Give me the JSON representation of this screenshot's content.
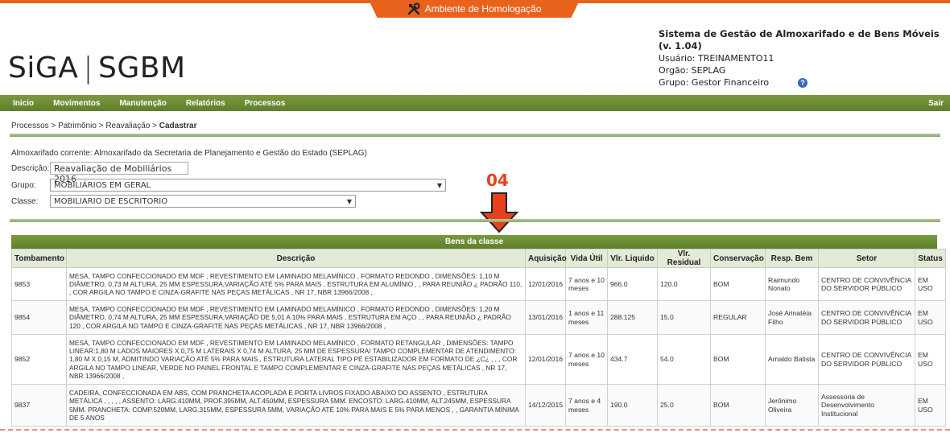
{
  "env_banner": {
    "label": "Ambiente de Homologação",
    "color": "#e8621c"
  },
  "logo": {
    "left": "SiGA",
    "right": "SGBM"
  },
  "sysinfo": {
    "title": "Sistema de Gestão de Almoxarifado e de Bens Móveis (v. 1.04)",
    "usuario": "Usuário: TREINAMENTO11",
    "orgao": "Orgão: SEPLAG",
    "grupo": "Grupo: Gestor Financeiro"
  },
  "menu": {
    "items": [
      "Inicio",
      "Movimentos",
      "Manutenção",
      "Relatórios",
      "Processos"
    ],
    "logout": "Sair"
  },
  "breadcrumb": {
    "items": [
      "Processos",
      "Patrimônio",
      "Reavaliação"
    ],
    "separator": ">",
    "current": "Cadastrar"
  },
  "form": {
    "almoxarifado": "Almoxarifado corrente: Almoxarifado da Secretaria de Planejamento e Gestão do Estado (SEPLAG)",
    "descricao_label": "Descrição:",
    "descricao_value": "Reavaliação de Mobiliários 2016",
    "grupo_label": "Grupo:",
    "grupo_value": "MOBILIÁRIOS EM GERAL",
    "classe_label": "Classe:",
    "classe_value": "MOBILIARIO DE ESCRITORIO"
  },
  "annotation": {
    "number": "04",
    "color": "#e8401c"
  },
  "table": {
    "caption": "Bens da classe",
    "headers": [
      "Tombamento",
      "Descrição",
      "Aquisição",
      "Vida Útil",
      "Vlr. Liquido",
      "Vlr. Residual",
      "Conservação",
      "Resp. Bem",
      "Setor",
      "Status"
    ],
    "rows": [
      [
        "9853",
        "MESA, TAMPO CONFECCIONADO EM MDF , REVESTIMENTO EM LAMINADO MELAMÍNICO , FORMATO REDONDO , DIMENSÕES: 1,10 M DIÂMETRO, 0,73 M ALTURA, 25 MM ESPESSURA,VARIAÇÃO ATÉ 5% PARA MAIS , ESTRUTURA EM ALUMÍNIO , , PARA REUNIÃO ¿ PADRÃO 110, , COR ARGILA NO TAMPO E CINZA-GRAFITE NAS PEÇAS METÁLICAS , NR 17, NBR 13966/2008 ,",
        "12/01/2016",
        "7 anos e 10 meses",
        "966.0",
        "120.0",
        "BOM",
        "Raimundo Nonato",
        "CENTRO DE CONVIVÊNCIA DO SERVIDOR PÚBLICO",
        "EM USO"
      ],
      [
        "9854",
        "MESA, TAMPO CONFECCIONADO EM MDF , REVESTIMENTO EM LAMINADO MELAMÍNICO , FORMATO REDONDO , DIMENSÕES: 1,20 M DIÂMETRO, 0,74 M ALTURA, 25 MM ESPESSURA,VARIAÇÃO DE 5,01 A 10% PARA MAIS , ESTRUTURA EM AÇO , , PARA REUNIÃO ¿ PADRÃO 120 , COR ARGILA NO TAMPO E CINZA-GRAFITE NAS PEÇAS METÁLICAS , NR 17, NBR 13966/2008 ,",
        "13/01/2016",
        "1 anos e 11 meses",
        "288.125",
        "15.0",
        "REGULAR",
        "José Arinatéia Filho",
        "CENTRO DE CONVIVÊNCIA DO SERVIDOR PÚBLICO",
        "EM USO"
      ],
      [
        "9852",
        "MESA, TAMPO CONFECCIONADO EM MDF , REVESTIMENTO EM LAMINADO MELAMÍNICO , FORMATO RETANGULAR , DIMENSÕES: TAMPO LINEAR:1,80 M LADOS MAIORES X 0,75 M LATERAIS X 0,74 M ALTURA, 25 MM DE ESPESSURA/ TAMPO COMPLEMENTAR DE ATENDIMENTO: 1,80 M X 0,15 M, ADMITINDO VARIAÇÃO ATÉ 5% PARA MAIS , ESTRUTURA LATERAL TIPO PÉ ESTABILIZADOR EM FORMATO DE ¿C¿ , , , COR ARGILA NO TAMPO LINEAR, VERDE NO PAINEL FRONTAL E TAMPO COMPLEMENTAR E CINZA-GRAFITE NAS PEÇAS METÁLICAS , NR 17, NBR 13966/2008 ,",
        "12/01/2016",
        "7 anos e 10 meses",
        "434.7",
        "54.0",
        "BOM",
        "Arnaldo Batista",
        "CENTRO DE CONVIVÊNCIA DO SERVIDOR PÚBLICO",
        "EM USO"
      ],
      [
        "9837",
        "CADEIRA, CONFECCIONADA EM ABS, COM PRANCHETA ACOPLADA E PORTA LIVROS FIXADO ABAIXO DO ASSENTO , ESTRUTURA METÁLICA , , , , , ASSENTO: LARG.410MM, PROF.395MM, ALT.450MM, ESPESSURA 5MM. ENCOSTO: LARG.410MM, ALT.245MM, ESPESSURA 5MM. PRANCHETA: COMP.520MM, LARG.315MM, ESPESSURA 5MM, VARIAÇÃO ATÉ 10% PARA MAIS E 5% PARA MENOS , , GARANTIA MÍNIMA DE 5 ANOS",
        "14/12/2015",
        "7 anos e 4 meses",
        "190.0",
        "25.0",
        "BOM",
        "Jerônimo Oliveira",
        "Assessoria de Desenvolvimento Institucional",
        "EM USO"
      ]
    ]
  }
}
